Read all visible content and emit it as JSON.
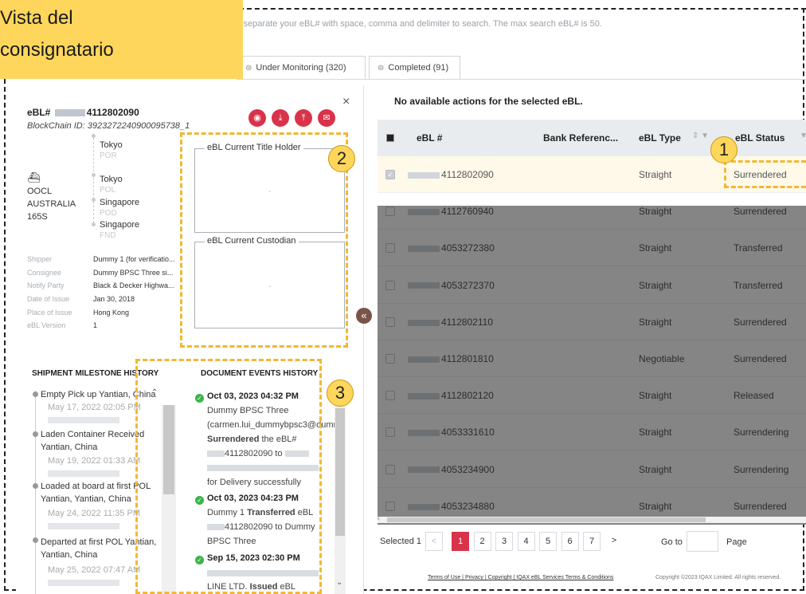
{
  "callout_title_line1": "Vista del",
  "callout_title_line2": "consignatario",
  "search_hint": "y separate your eBL# with space, comma and delimiter to search. The max search eBL# is 50.",
  "tabs": [
    {
      "label": "Under Monitoring (320)"
    },
    {
      "label": "Completed (91)"
    }
  ],
  "detail": {
    "ebl_prefix": "eBL#",
    "ebl_suffix": "4112802090",
    "chain_id": "BlockChain ID: 3923272240900095738_1",
    "close": "×",
    "vessel_line1": "OOCL",
    "vessel_line2": "AUSTRALIA",
    "vessel_line3": "165S",
    "route": [
      {
        "city": "Tokyo",
        "code": "POR"
      },
      {
        "city": "Tokyo",
        "code": "POL"
      },
      {
        "city": "Singapore",
        "code": "POD"
      },
      {
        "city": "Singapore",
        "code": "FND"
      }
    ],
    "fields": [
      {
        "k": "Shipper",
        "v": "Dummy 1 (for verificatio..."
      },
      {
        "k": "Consignee",
        "v": "Dummy BPSC Three si..."
      },
      {
        "k": "Notify Party",
        "v": "Black & Decker Highwa..."
      },
      {
        "k": "Date of Issue",
        "v": "Jan 30, 2018"
      },
      {
        "k": "Place of Issue",
        "v": "Hong Kong"
      },
      {
        "k": "eBL Version",
        "v": "1"
      }
    ],
    "title_holder_label": "eBL Current Title Holder",
    "title_holder_value": "-",
    "custodian_label": "eBL Current Custodian",
    "custodian_value": "-"
  },
  "badges": [
    "1",
    "2",
    "3"
  ],
  "milestones": {
    "title": "SHIPMENT MILESTONE HISTORY",
    "items": [
      {
        "event": "Empty Pick up Yantian, China",
        "date": "May 17, 2022 02:05 PM"
      },
      {
        "event": "Laden Container Received Yantian, China",
        "date": "May 19, 2022 01:33 AM"
      },
      {
        "event": "Loaded at board at first POL Yantian, Yantian, China",
        "date": "May 24, 2022 11:35 PM"
      },
      {
        "event": "Departed at first POL Yantian, Yantian, China",
        "date": "May 25, 2022 07:47 AM"
      }
    ]
  },
  "events": {
    "title": "DOCUMENT EVENTS HISTORY",
    "items": [
      {
        "date": "Oct 03, 2023 04:32 PM",
        "line1": "Dummy BPSC Three",
        "line2": "(carmen.lui_dummybpsc3@dumm",
        "line3_bold": "Surrendered",
        "line3_rest": " the eBL#",
        "line4_tail": "4112802090 to",
        "line6": "for Delivery successfully"
      },
      {
        "date": "Oct 03, 2023 04:23 PM",
        "line1": "Dummy 1",
        "line1_bold": "Transferred",
        "line1_rest": " eBL",
        "line2_tail": "4112802090 to Dummy",
        "line3": "BPSC Three"
      },
      {
        "date": "Sep 15, 2023 02:30 PM",
        "line3_pre": "LINE LTD. ",
        "line3_bold": "Issued",
        "line3_rest": " eBL"
      }
    ]
  },
  "table": {
    "no_actions": "No available actions for the selected eBL.",
    "headers": [
      "eBL #",
      "Bank Referenc...",
      "eBL Type",
      "eBL Status"
    ],
    "rows": [
      {
        "id": "4112802090",
        "type": "Straight",
        "status": "Surrendered",
        "checked": true
      },
      {
        "id": "4112760940",
        "type": "Straight",
        "status": "Surrendered",
        "checked": false
      },
      {
        "id": "4053272380",
        "type": "Straight",
        "status": "Transferred",
        "checked": false
      },
      {
        "id": "4053272370",
        "type": "Straight",
        "status": "Transferred",
        "checked": false
      },
      {
        "id": "4112802110",
        "type": "Straight",
        "status": "Surrendered",
        "checked": false
      },
      {
        "id": "4112801810",
        "type": "Negotiable",
        "status": "Surrendered",
        "checked": false
      },
      {
        "id": "4112802120",
        "type": "Straight",
        "status": "Released",
        "checked": false
      },
      {
        "id": "4053331610",
        "type": "Straight",
        "status": "Surrendering",
        "checked": false
      },
      {
        "id": "4053234900",
        "type": "Straight",
        "status": "Surrendering",
        "checked": false
      },
      {
        "id": "4053234880",
        "type": "Straight",
        "status": "Surrendered",
        "checked": false
      }
    ]
  },
  "pager": {
    "selected": "Selected 1",
    "prev": "<",
    "pages": [
      "1",
      "2",
      "3",
      "4",
      "5",
      "6",
      "7"
    ],
    "next": ">",
    "goto": "Go to",
    "page": "Page"
  },
  "footer": {
    "links": "Terms of Use | Privacy | Copyright | IQAX eBL Services Terms & Conditions",
    "copy": "Copyright ©2023 IQAX Limited. All rights reserved."
  },
  "colors": {
    "accent": "#d8334a",
    "callout": "#ffd65c",
    "callout_border": "#f2b830"
  }
}
